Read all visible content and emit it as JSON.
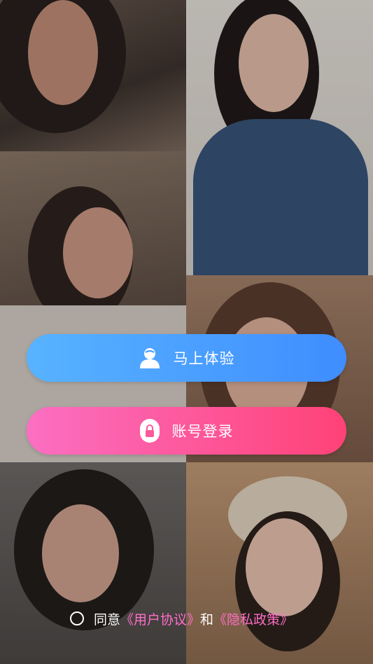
{
  "buttons": {
    "try_now": {
      "label": "马上体验",
      "icon": "user-icon",
      "color_start": "#58b3ff",
      "color_end": "#3f8dff"
    },
    "account_login": {
      "label": "账号登录",
      "icon": "lock-icon",
      "color_start": "#fb6fc2",
      "color_end": "#ff4277"
    }
  },
  "agreement": {
    "prefix": "同意",
    "user_agreement": "《用户协议》",
    "conjunction": "和",
    "privacy_policy": "《隐私政策》",
    "link_color": "#ff6ec7",
    "checked": false
  }
}
